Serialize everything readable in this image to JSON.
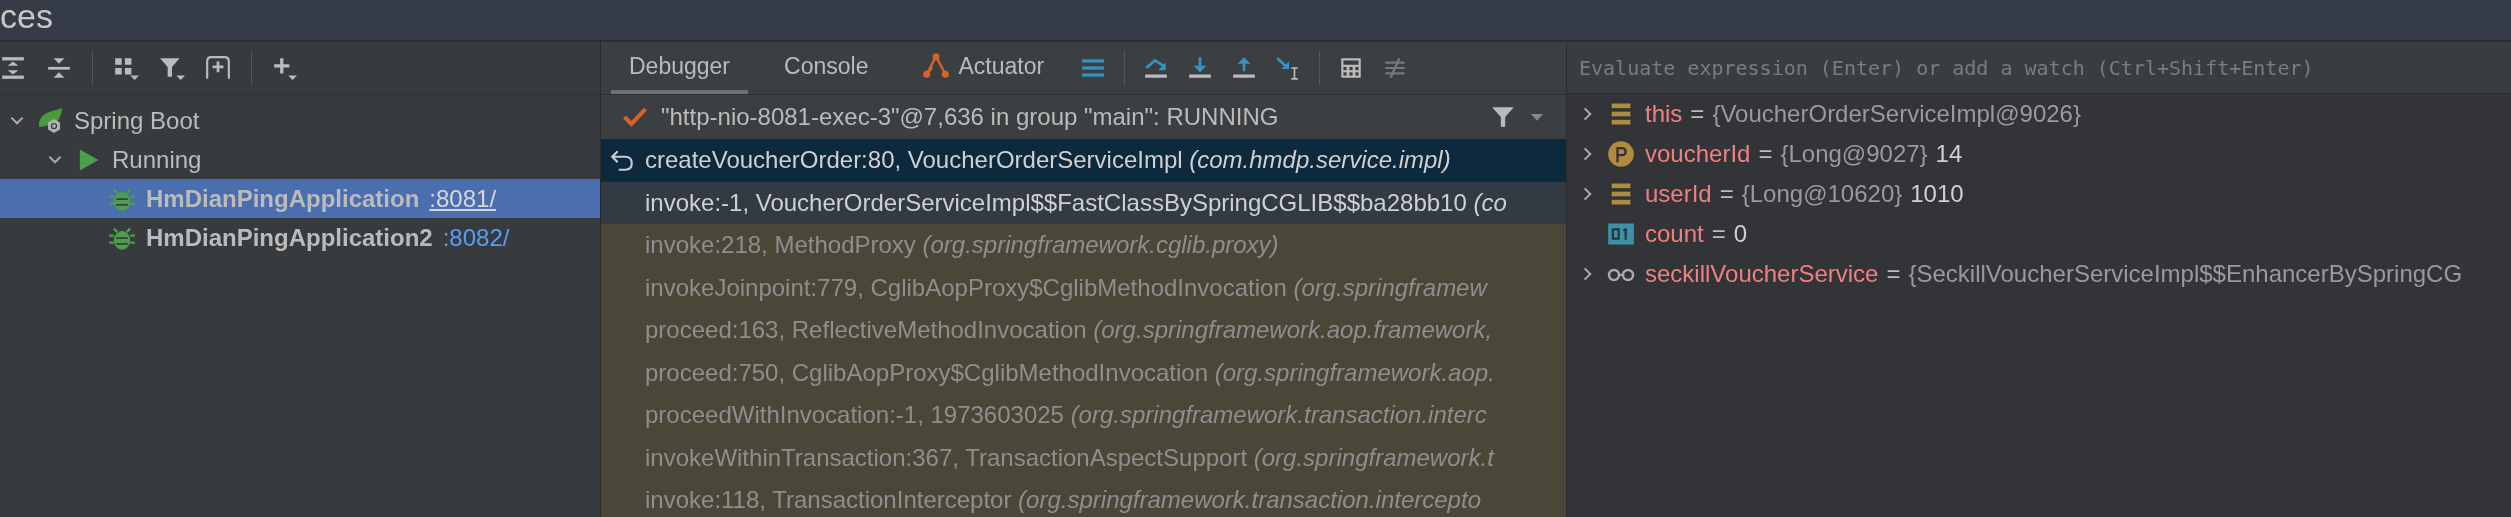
{
  "window": {
    "title": "ces"
  },
  "left_toolbar": [
    {
      "kind": "expand"
    },
    {
      "kind": "collapse"
    },
    {
      "kind": "group"
    },
    {
      "kind": "filter"
    },
    {
      "kind": "add-service"
    },
    {
      "kind": "add"
    }
  ],
  "tree": [
    {
      "label": "Spring Boot",
      "kind": "spring",
      "expanded": true,
      "selected": false,
      "children": [
        {
          "label": "Running",
          "kind": "running",
          "expanded": true,
          "selected": false,
          "children": [
            {
              "label": "HmDianPingApplication",
              "port": ":8081/",
              "kind": "app",
              "selected": true
            },
            {
              "label": "HmDianPingApplication2",
              "port": ":8082/",
              "kind": "app",
              "selected": false
            }
          ]
        }
      ]
    }
  ],
  "tabs": [
    {
      "label": "Debugger",
      "kind": "plain",
      "selected": true
    },
    {
      "label": "Console",
      "kind": "plain",
      "selected": false
    },
    {
      "label": "Actuator",
      "kind": "actuator",
      "selected": false
    }
  ],
  "debug_toolbar": [
    {
      "kind": "frames",
      "disabled": false
    },
    {
      "kind": "step-over",
      "disabled": false
    },
    {
      "kind": "step-into",
      "disabled": false
    },
    {
      "kind": "step-out",
      "disabled": false
    },
    {
      "kind": "run-to-cursor",
      "disabled": false
    },
    {
      "kind": "evaluate",
      "disabled": false
    },
    {
      "kind": "trace",
      "disabled": true
    }
  ],
  "thread": {
    "label": "\"http-nio-8081-exec-3\"@7,636 in group \"main\": RUNNING"
  },
  "frames": [
    {
      "method": "createVoucherOrder:80, VoucherOrderServiceImpl",
      "package": "(com.hmdp.service.impl)",
      "kind": "app",
      "selected": true
    },
    {
      "method": "invoke:-1, VoucherOrderServiceImpl$$FastClassBySpringCGLIB$$ba28bb10",
      "package": "(co",
      "kind": "app",
      "selected": false
    },
    {
      "method": "invoke:218, MethodProxy",
      "package": "(org.springframework.cglib.proxy)",
      "kind": "library",
      "selected": false
    },
    {
      "method": "invokeJoinpoint:779, CglibAopProxy$CglibMethodInvocation",
      "package": "(org.springframew",
      "kind": "library",
      "selected": false
    },
    {
      "method": "proceed:163, ReflectiveMethodInvocation",
      "package": "(org.springframework.aop.framework,",
      "kind": "library",
      "selected": false
    },
    {
      "method": "proceed:750, CglibAopProxy$CglibMethodInvocation",
      "package": "(org.springframework.aop.",
      "kind": "library",
      "selected": false
    },
    {
      "method": "proceedWithInvocation:-1, 1973603025",
      "package": "(org.springframework.transaction.interc",
      "kind": "library",
      "selected": false
    },
    {
      "method": "invokeWithinTransaction:367, TransactionAspectSupport",
      "package": "(org.springframework.t",
      "kind": "library",
      "selected": false
    },
    {
      "method": "invoke:118, TransactionInterceptor",
      "package": "(org.springframework.transaction.intercepto",
      "kind": "library",
      "selected": false
    }
  ],
  "evaluate": {
    "placeholder": "Evaluate expression (Enter) or add a watch (Ctrl+Shift+Enter)"
  },
  "variables": [
    {
      "name": "this",
      "op": "=",
      "type": "{VoucherOrderServiceImpl@9026}",
      "kind": "field",
      "expandable": true
    },
    {
      "name": "voucherId",
      "op": "=",
      "type": "{Long@9027}",
      "value": "14",
      "kind": "param",
      "expandable": true
    },
    {
      "name": "userId",
      "op": "=",
      "type": "{Long@10620}",
      "value": "1010",
      "kind": "field",
      "expandable": true
    },
    {
      "name": "count",
      "op": "=",
      "value": "0",
      "kind": "primitive",
      "expandable": false
    },
    {
      "name": "seckillVoucherService",
      "op": "=",
      "type": "{SeckillVoucherServiceImpl$$EnhancerBySpringCG",
      "kind": "watch",
      "expandable": true
    }
  ]
}
